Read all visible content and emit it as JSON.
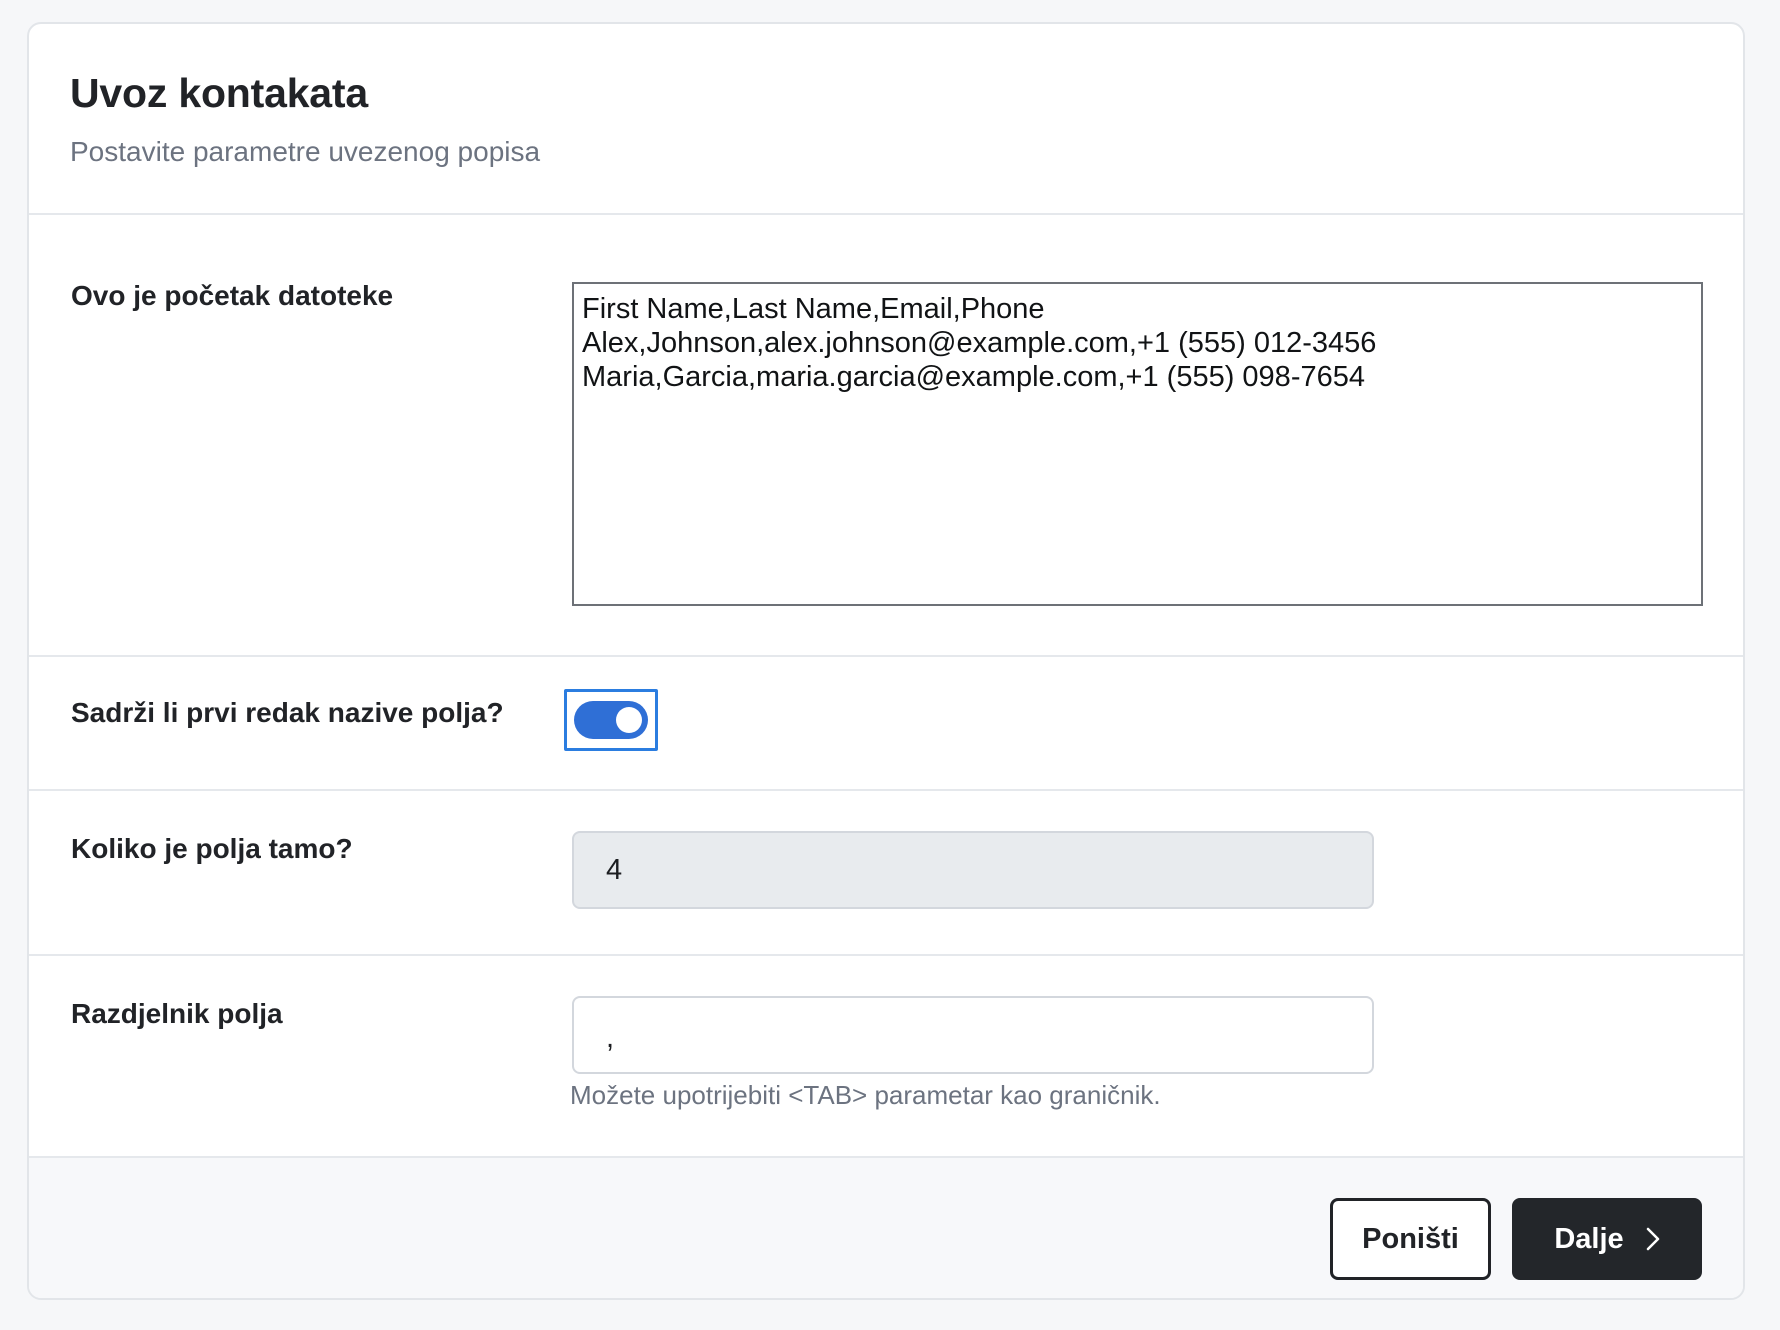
{
  "header": {
    "title": "Uvoz kontakata",
    "subtitle": "Postavite parametre uvezenog popisa"
  },
  "preview": {
    "label": "Ovo je početak datoteke",
    "content": "First Name,Last Name,Email,Phone\nAlex,Johnson,alex.johnson@example.com,+1 (555) 012-3456\nMaria,Garcia,maria.garcia@example.com,+1 (555) 098-7654"
  },
  "header_row": {
    "label": "Sadrži li prvi redak nazive polja?",
    "toggle_on": true,
    "accent_color": "#2f6fd6",
    "focus_color": "#2b7de0"
  },
  "field_count": {
    "label": "Koliko je polja tamo?",
    "value": "4"
  },
  "separator": {
    "label": "Razdjelnik polja",
    "value": ",",
    "hint": "Možete upotrijebiti <TAB> parametar kao graničnik."
  },
  "footer": {
    "cancel_label": "Poništi",
    "next_label": "Dalje",
    "next_icon": "chevron-right-icon"
  }
}
